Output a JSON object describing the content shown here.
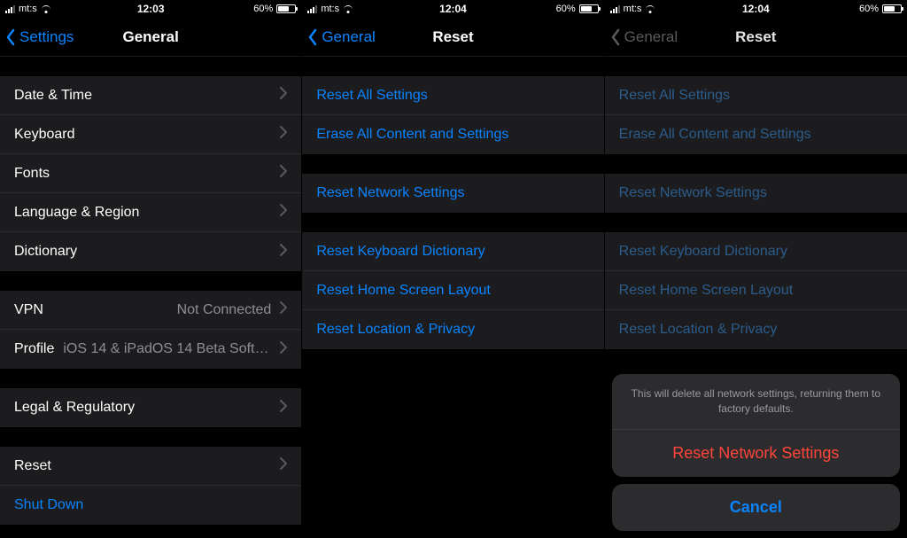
{
  "status": {
    "carrier": "mt:s",
    "battery_pct": "60%"
  },
  "screen1": {
    "time": "12:03",
    "back_label": "Settings",
    "title": "General",
    "g1": {
      "date_time": "Date & Time",
      "keyboard": "Keyboard",
      "fonts": "Fonts",
      "lang_region": "Language & Region",
      "dictionary": "Dictionary"
    },
    "g2": {
      "vpn": "VPN",
      "vpn_value": "Not Connected",
      "profile": "Profile",
      "profile_value": "iOS 14 & iPadOS 14 Beta Softwar..."
    },
    "g3": {
      "legal": "Legal & Regulatory"
    },
    "g4": {
      "reset": "Reset",
      "shutdown": "Shut Down"
    }
  },
  "screen2": {
    "time": "12:04",
    "back_label": "General",
    "title": "Reset",
    "g1": {
      "reset_all": "Reset All Settings",
      "erase_all": "Erase All Content and Settings"
    },
    "g2": {
      "reset_network": "Reset Network Settings"
    },
    "g3": {
      "reset_keyboard": "Reset Keyboard Dictionary",
      "reset_home": "Reset Home Screen Layout",
      "reset_location": "Reset Location & Privacy"
    }
  },
  "screen3": {
    "time": "12:04",
    "back_label": "General",
    "title": "Reset",
    "g1": {
      "reset_all": "Reset All Settings",
      "erase_all": "Erase All Content and Settings"
    },
    "g2": {
      "reset_network": "Reset Network Settings"
    },
    "g3": {
      "reset_keyboard": "Reset Keyboard Dictionary",
      "reset_home": "Reset Home Screen Layout",
      "reset_location": "Reset Location & Privacy"
    },
    "sheet": {
      "message": "This will delete all network settings, returning them to factory defaults.",
      "destructive": "Reset Network Settings",
      "cancel": "Cancel"
    }
  },
  "colors": {
    "accent": "#0a84ff",
    "destructive": "#ff453a",
    "secondary": "#8e8e93",
    "row_bg": "#1c1c1e",
    "sheet_bg": "#2c2c2e"
  }
}
